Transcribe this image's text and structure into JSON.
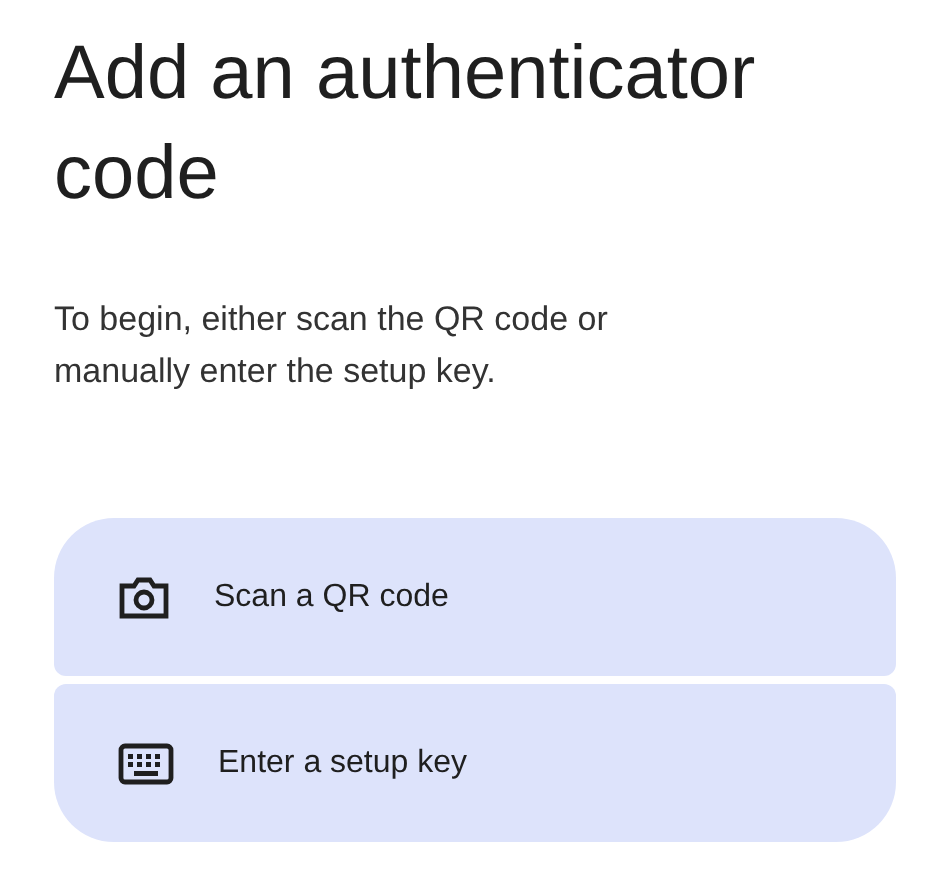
{
  "title": "Add an authenticator code",
  "description": "To begin, either scan the QR code or manually enter the setup key.",
  "options": [
    {
      "kind": "camera",
      "label": "Scan a QR code"
    },
    {
      "kind": "keyboard",
      "label": "Enter a setup key"
    }
  ]
}
